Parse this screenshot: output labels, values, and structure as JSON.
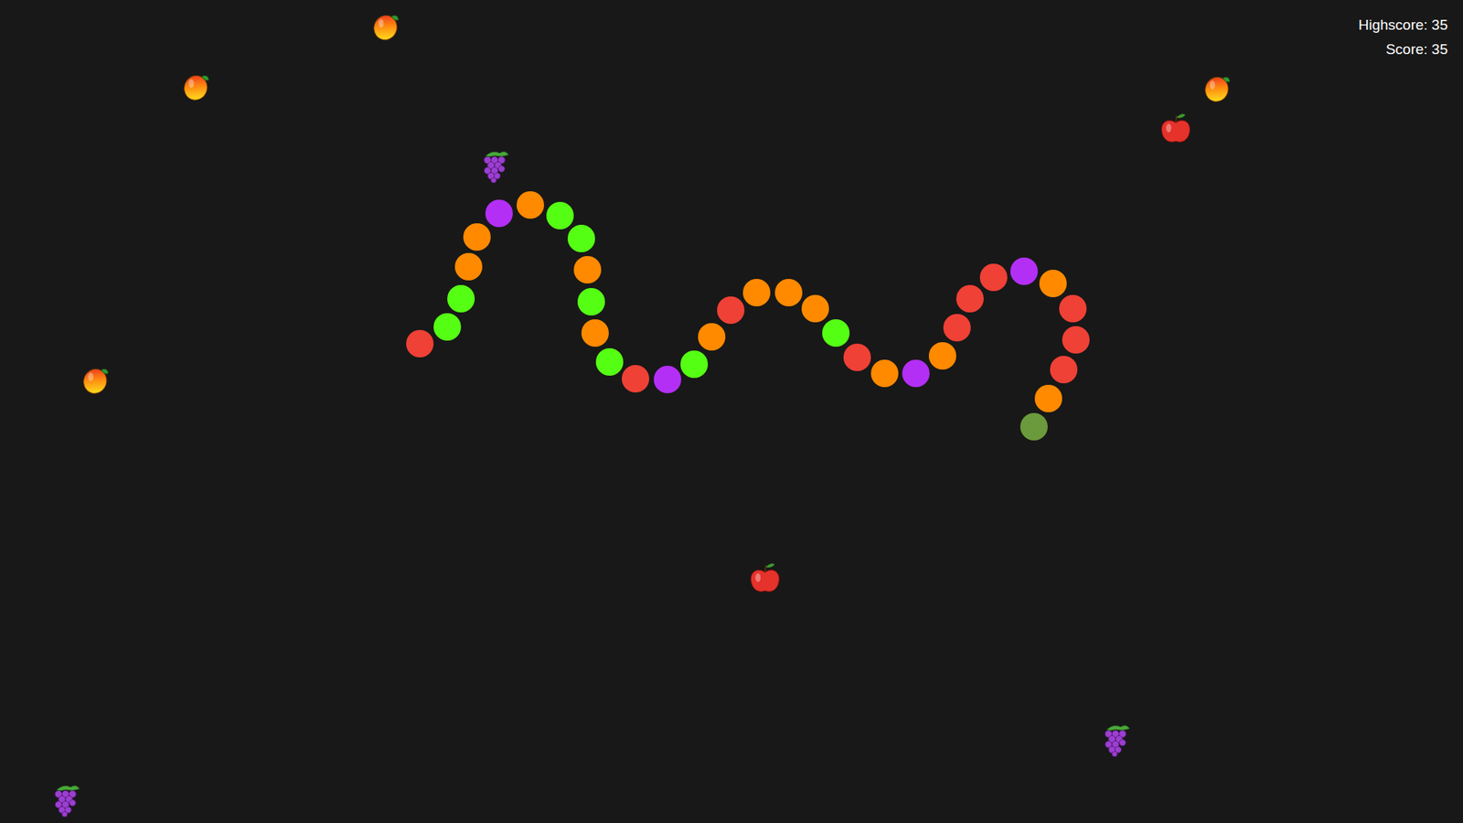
{
  "score": {
    "highscore": "Highscore: 35",
    "score": "Score: 35"
  },
  "snake": {
    "segments": [
      {
        "color": "#ef4136"
      },
      {
        "color": "#55ff14"
      },
      {
        "color": "#55ff14"
      },
      {
        "color": "#ff8a00"
      },
      {
        "color": "#ff8a00"
      },
      {
        "color": "#b32ff5"
      },
      {
        "color": "#ff8a00"
      },
      {
        "color": "#55ff14"
      },
      {
        "color": "#55ff14"
      },
      {
        "color": "#ff8a00"
      },
      {
        "color": "#55ff14"
      },
      {
        "color": "#ff8a00"
      },
      {
        "color": "#55ff14"
      },
      {
        "color": "#ef4136"
      },
      {
        "color": "#b32ff5"
      },
      {
        "color": "#55ff14"
      },
      {
        "color": "#ff8a00"
      },
      {
        "color": "#ef4136"
      },
      {
        "color": "#ff8a00"
      },
      {
        "color": "#ff8a00"
      },
      {
        "color": "#ff8a00"
      },
      {
        "color": "#55ff14"
      },
      {
        "color": "#ef4136"
      },
      {
        "color": "#ff8a00"
      },
      {
        "color": "#b32ff5"
      },
      {
        "color": "#ff8a00"
      },
      {
        "color": "#ef4136"
      },
      {
        "color": "#ef4136"
      },
      {
        "color": "#ef4136"
      },
      {
        "color": "#b32ff5"
      },
      {
        "color": "#ff8a00"
      },
      {
        "color": "#ef4136"
      },
      {
        "color": "#ef4136"
      },
      {
        "color": "#ef4136"
      },
      {
        "color": "#ff8a00"
      },
      {
        "color": "#6b9a3c"
      }
    ]
  },
  "fruits": [
    {
      "kind": "mango"
    },
    {
      "kind": "mango"
    },
    {
      "kind": "mango"
    },
    {
      "kind": "apple"
    },
    {
      "kind": "grape"
    },
    {
      "kind": "mango"
    },
    {
      "kind": "apple"
    },
    {
      "kind": "grape"
    },
    {
      "kind": "grape"
    }
  ]
}
